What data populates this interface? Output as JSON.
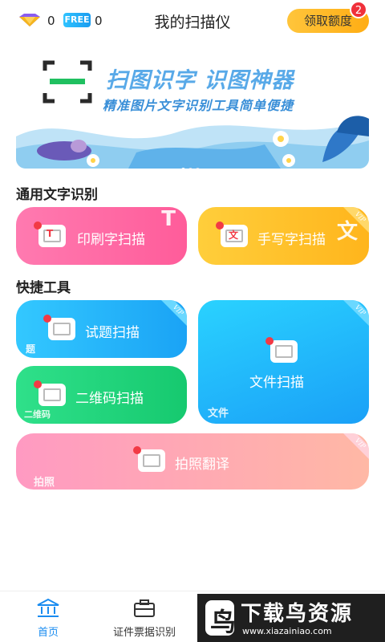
{
  "header": {
    "gem_count": "0",
    "free_badge": "FREE",
    "free_count": "0",
    "title": "我的扫描仪",
    "quota_button": "领取额度",
    "quota_badge": "2"
  },
  "banner": {
    "title": "扫图识字 识图神器",
    "subtitle": "精准图片文字识别工具简单便捷"
  },
  "sections": {
    "ocr": "通用文字识别",
    "tools": "快捷工具"
  },
  "cards": {
    "print_scan": {
      "label": "印刷字扫描",
      "icon": "T",
      "glyph": "T"
    },
    "handwriting_scan": {
      "label": "手写字扫描",
      "icon": "文",
      "glyph": "文",
      "vip": "VIP"
    },
    "exam_scan": {
      "label": "试题扫描",
      "watermark": "题",
      "vip": "VIP"
    },
    "qr_scan": {
      "label": "二维码扫描",
      "watermark": "二维码"
    },
    "file_scan": {
      "label": "文件扫描",
      "watermark": "文件",
      "vip": "VIP"
    },
    "photo_translate": {
      "label": "拍照翻译",
      "watermark": "拍照",
      "vip": "VIP"
    }
  },
  "bottom_nav": {
    "home": "首页",
    "id_recognition": "证件票据识别"
  },
  "ad": {
    "logo_char": "鸟",
    "title": "下载鸟资源",
    "url": "www.xiazainiao.com"
  },
  "colors": {
    "accent": "#1a8cf0",
    "print_card": "#ff6aa5",
    "handwriting_card": "#ffc12c",
    "exam_card": "#26b6fa",
    "qr_card": "#22d57d",
    "file_card": "#20b8fa",
    "photo_card": "#ffa8b5",
    "quota_button": "#ffb81e",
    "badge_red": "#f0303a"
  },
  "icons": {
    "gem": "diamond-icon",
    "home": "bank-icon",
    "id": "briefcase-icon"
  }
}
